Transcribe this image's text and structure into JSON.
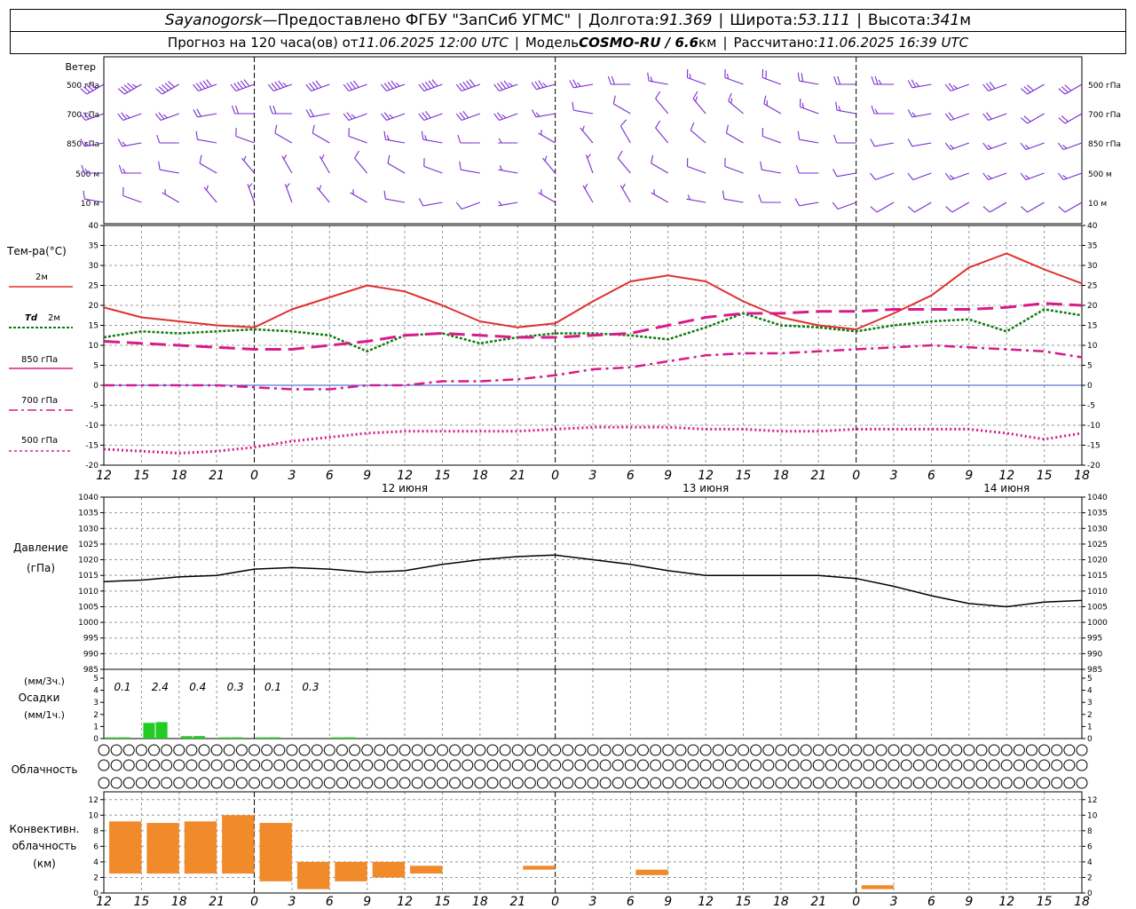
{
  "header": {
    "station": "Sayanogorsk",
    "dash": " — ",
    "provider": "Предоставлено ФГБУ \"ЗапСиб УГМС\"",
    "lon_label": "Долгота: ",
    "lon": "91.369",
    "lat_label": "Широта: ",
    "lat": "53.111",
    "alt_label": "Высота: ",
    "alt": "341",
    "alt_unit": "м",
    "forecast_label": "Прогноз на 120 часа(ов) от ",
    "forecast_start": "11.06.2025 12:00 UTC",
    "model_label": "Модель ",
    "model": "COSMO-RU / 6.6",
    "model_unit": "км",
    "computed_label": "Рассчитано: ",
    "computed": "11.06.2025 16:39 UTC"
  },
  "hours": [
    "12",
    "15",
    "18",
    "21",
    "0",
    "3",
    "6",
    "9",
    "12",
    "15",
    "18",
    "21",
    "0",
    "3",
    "6",
    "9",
    "12",
    "15",
    "18",
    "21",
    "0",
    "3",
    "6",
    "9",
    "12",
    "15",
    "18"
  ],
  "dates": [
    {
      "index": 8,
      "label": "12 июня"
    },
    {
      "index": 16,
      "label": "13 июня"
    },
    {
      "index": 24,
      "label": "14 июня"
    }
  ],
  "midnight_indices": [
    4,
    12,
    20
  ],
  "colors": {
    "wind": "#7a2bd0",
    "t2m": "#e03030",
    "td2m": "#107a10",
    "t850": "#d81b8a",
    "t700": "#d81b8a",
    "t500": "#d81b8a",
    "zero_line": "#3050d0",
    "pressure": "#000000",
    "precip": "#22cc22",
    "convective": "#f08a2a",
    "grid": "#999999"
  },
  "wind": {
    "title": "Ветер",
    "levels": [
      "500 гПа",
      "700 гПа",
      "850 гПа",
      "500 м",
      "10 м"
    ],
    "direction_deg": [
      [
        240,
        240,
        240,
        250,
        250,
        250,
        250,
        250,
        250,
        250,
        250,
        250,
        255,
        260,
        270,
        280,
        290,
        290,
        290,
        280,
        270,
        270,
        260,
        250,
        250,
        240,
        240
      ],
      [
        250,
        250,
        250,
        260,
        270,
        270,
        260,
        250,
        250,
        250,
        250,
        250,
        260,
        280,
        300,
        320,
        320,
        310,
        300,
        290,
        280,
        270,
        260,
        250,
        250,
        240,
        240
      ],
      [
        260,
        260,
        270,
        280,
        290,
        300,
        300,
        290,
        280,
        280,
        270,
        270,
        300,
        320,
        330,
        320,
        310,
        300,
        290,
        280,
        270,
        260,
        260,
        250,
        250,
        250,
        250
      ],
      [
        270,
        270,
        280,
        300,
        320,
        330,
        330,
        320,
        300,
        290,
        280,
        280,
        320,
        340,
        320,
        300,
        290,
        290,
        280,
        270,
        260,
        250,
        250,
        250,
        250,
        250,
        250
      ],
      [
        280,
        290,
        300,
        320,
        340,
        340,
        320,
        300,
        280,
        260,
        250,
        260,
        300,
        330,
        330,
        300,
        280,
        280,
        270,
        260,
        250,
        240,
        240,
        240,
        240,
        240,
        240
      ]
    ],
    "speed_kt": [
      [
        40,
        45,
        50,
        50,
        50,
        45,
        40,
        40,
        45,
        50,
        50,
        45,
        35,
        25,
        20,
        15,
        15,
        15,
        20,
        20,
        20,
        25,
        25,
        25,
        30,
        30,
        30
      ],
      [
        25,
        25,
        25,
        20,
        20,
        20,
        20,
        25,
        25,
        30,
        30,
        25,
        15,
        10,
        10,
        10,
        15,
        15,
        15,
        15,
        15,
        15,
        15,
        20,
        20,
        20,
        20
      ],
      [
        15,
        15,
        10,
        10,
        10,
        10,
        10,
        10,
        15,
        15,
        10,
        5,
        5,
        5,
        10,
        10,
        10,
        10,
        10,
        10,
        10,
        10,
        10,
        15,
        15,
        15,
        15
      ],
      [
        15,
        15,
        10,
        10,
        5,
        5,
        5,
        10,
        10,
        10,
        10,
        5,
        5,
        5,
        10,
        10,
        10,
        10,
        10,
        10,
        10,
        10,
        10,
        15,
        15,
        15,
        15
      ],
      [
        10,
        10,
        5,
        5,
        5,
        5,
        5,
        5,
        10,
        10,
        10,
        5,
        5,
        5,
        5,
        5,
        5,
        10,
        10,
        10,
        10,
        10,
        10,
        10,
        10,
        10,
        10
      ]
    ]
  },
  "temperature": {
    "title": "Тем-ра(°C)",
    "ylim": [
      -20,
      40
    ],
    "ticks": [
      40,
      35,
      30,
      25,
      20,
      15,
      10,
      5,
      0,
      -5,
      -10,
      -15,
      -20
    ],
    "legend": {
      "t2m": "2м",
      "td_prefix": "Td",
      "td_suffix": "2м",
      "t850": "850 гПа",
      "t700": "700 гПа",
      "t500": "500 гПа"
    }
  },
  "pressure": {
    "title_line1": "Давление",
    "title_line2": "(гПа)",
    "ylim": [
      985,
      1040
    ],
    "ticks": [
      1040,
      1035,
      1030,
      1025,
      1020,
      1015,
      1010,
      1005,
      1000,
      995,
      990,
      985
    ]
  },
  "precip": {
    "title_top": "(мм/3ч.)",
    "title_mid": "Осадки",
    "title_bot": "(мм/1ч.)",
    "ylim": [
      0,
      5
    ],
    "ticks": [
      5,
      4,
      3,
      2,
      1,
      0
    ],
    "totals_3h": [
      "0.1",
      "2.4",
      "0.4",
      "0.3",
      "0.1",
      "0.3"
    ]
  },
  "clouds": {
    "title": "Облачность",
    "rows": [
      "high",
      "medium",
      "low"
    ]
  },
  "convective": {
    "title_line1": "Конвективн.",
    "title_line2": "облачность",
    "title_line3": "(км)",
    "ylim": [
      0,
      13
    ],
    "ticks": [
      12,
      10,
      8,
      6,
      4,
      2,
      0
    ]
  },
  "chart_data": [
    {
      "type": "line",
      "title": "Тем-ра(°C)",
      "x": [
        "12",
        "15",
        "18",
        "21",
        "0",
        "3",
        "6",
        "9",
        "12",
        "15",
        "18",
        "21",
        "0",
        "3",
        "6",
        "9",
        "12",
        "15",
        "18",
        "21",
        "0",
        "3",
        "6",
        "9",
        "12",
        "15",
        "18"
      ],
      "ylim": [
        -20,
        40
      ],
      "series": [
        {
          "name": "2м",
          "values": [
            19.5,
            17,
            16,
            15,
            14.5,
            19,
            22,
            25,
            23.5,
            20,
            16,
            14.5,
            15.5,
            21,
            26,
            27.5,
            26,
            21,
            17,
            15,
            14,
            18,
            22.5,
            29.5,
            33,
            29,
            25.5
          ]
        },
        {
          "name": "Td 2м",
          "values": [
            12,
            13.5,
            13,
            13.5,
            14,
            13.5,
            12.5,
            8.5,
            12.5,
            13,
            10.5,
            12,
            13,
            13,
            12.5,
            11.5,
            14.5,
            18,
            15,
            14.5,
            13.5,
            15,
            16,
            16.5,
            13.5,
            19,
            17.5
          ]
        },
        {
          "name": "850 гПа",
          "values": [
            11,
            10.5,
            10,
            9.5,
            9,
            9,
            10,
            11,
            12.5,
            13,
            12.5,
            12,
            12,
            12.5,
            13,
            15,
            17,
            18,
            18,
            18.5,
            18.5,
            19,
            19,
            19,
            19.5,
            20.5,
            20
          ]
        },
        {
          "name": "700 гПа",
          "values": [
            0,
            0,
            0,
            0,
            -0.5,
            -1,
            -1,
            0,
            0,
            1,
            1,
            1.5,
            2.5,
            4,
            4.5,
            6,
            7.5,
            8,
            8,
            8.5,
            9,
            9.5,
            10,
            9.5,
            9,
            8.5,
            7
          ]
        },
        {
          "name": "500 гПа",
          "values": [
            -16,
            -16.5,
            -17,
            -16.5,
            -15.5,
            -14,
            -13,
            -12,
            -11.5,
            -11.5,
            -11.5,
            -11.5,
            -11,
            -10.5,
            -10.5,
            -10.5,
            -11,
            -11,
            -11.5,
            -11.5,
            -11,
            -11,
            -11,
            -11,
            -12,
            -13.5,
            -12
          ]
        }
      ]
    },
    {
      "type": "line",
      "title": "Давление (гПа)",
      "x": [
        "12",
        "15",
        "18",
        "21",
        "0",
        "3",
        "6",
        "9",
        "12",
        "15",
        "18",
        "21",
        "0",
        "3",
        "6",
        "9",
        "12",
        "15",
        "18",
        "21",
        "0",
        "3",
        "6",
        "9",
        "12",
        "15",
        "18"
      ],
      "ylim": [
        985,
        1040
      ],
      "series": [
        {
          "values": [
            1013,
            1013.5,
            1014.5,
            1015,
            1017,
            1017.5,
            1017,
            1016,
            1016.5,
            1018.5,
            1020,
            1021,
            1021.5,
            1020,
            1018.5,
            1016.5,
            1015,
            1015,
            1015,
            1015,
            1014,
            1011.5,
            1008.5,
            1006,
            1005,
            1006.5,
            1007
          ]
        }
      ]
    },
    {
      "type": "bar",
      "title": "Осадки (мм/1ч.)",
      "x": [
        "12",
        "15",
        "18",
        "21",
        "0",
        "3",
        "6",
        "9",
        "12",
        "15",
        "18",
        "21",
        "0",
        "3",
        "6",
        "9",
        "12",
        "15",
        "18",
        "21",
        "0",
        "3",
        "6",
        "9",
        "12",
        "15",
        "18"
      ],
      "ylim": [
        0,
        5
      ],
      "series": [
        {
          "values": [
            0.1,
            1.3,
            0.2,
            0.1,
            0.1,
            0,
            0.1,
            0,
            0,
            0,
            0,
            0,
            0,
            0,
            0,
            0,
            0,
            0,
            0,
            0,
            0,
            0,
            0,
            0,
            0,
            0,
            0
          ]
        }
      ]
    },
    {
      "type": "bar",
      "title": "Конвективн. облачность (км)",
      "x": [
        "12",
        "15",
        "18",
        "21",
        "0",
        "3",
        "6",
        "9",
        "12",
        "15",
        "18",
        "21",
        "0",
        "3",
        "6",
        "9",
        "12",
        "15",
        "18",
        "21",
        "0",
        "3",
        "6",
        "9",
        "12",
        "15",
        "18"
      ],
      "ylim": [
        0,
        13
      ],
      "series": [
        {
          "name": "base",
          "values": [
            2.5,
            2.5,
            2.5,
            2.5,
            1.5,
            0.5,
            1.5,
            2,
            2.5,
            0,
            0,
            3,
            0,
            0,
            2.3,
            0,
            0,
            0,
            0,
            0,
            0.5,
            0,
            0,
            0,
            0,
            0,
            0
          ]
        },
        {
          "name": "top",
          "values": [
            9.2,
            9,
            9.2,
            10,
            9,
            4,
            4,
            4,
            3.5,
            0,
            0,
            3.5,
            0,
            0,
            3,
            0,
            0,
            0,
            0,
            0,
            1,
            0,
            0,
            0,
            0,
            0,
            0
          ]
        }
      ]
    }
  ]
}
